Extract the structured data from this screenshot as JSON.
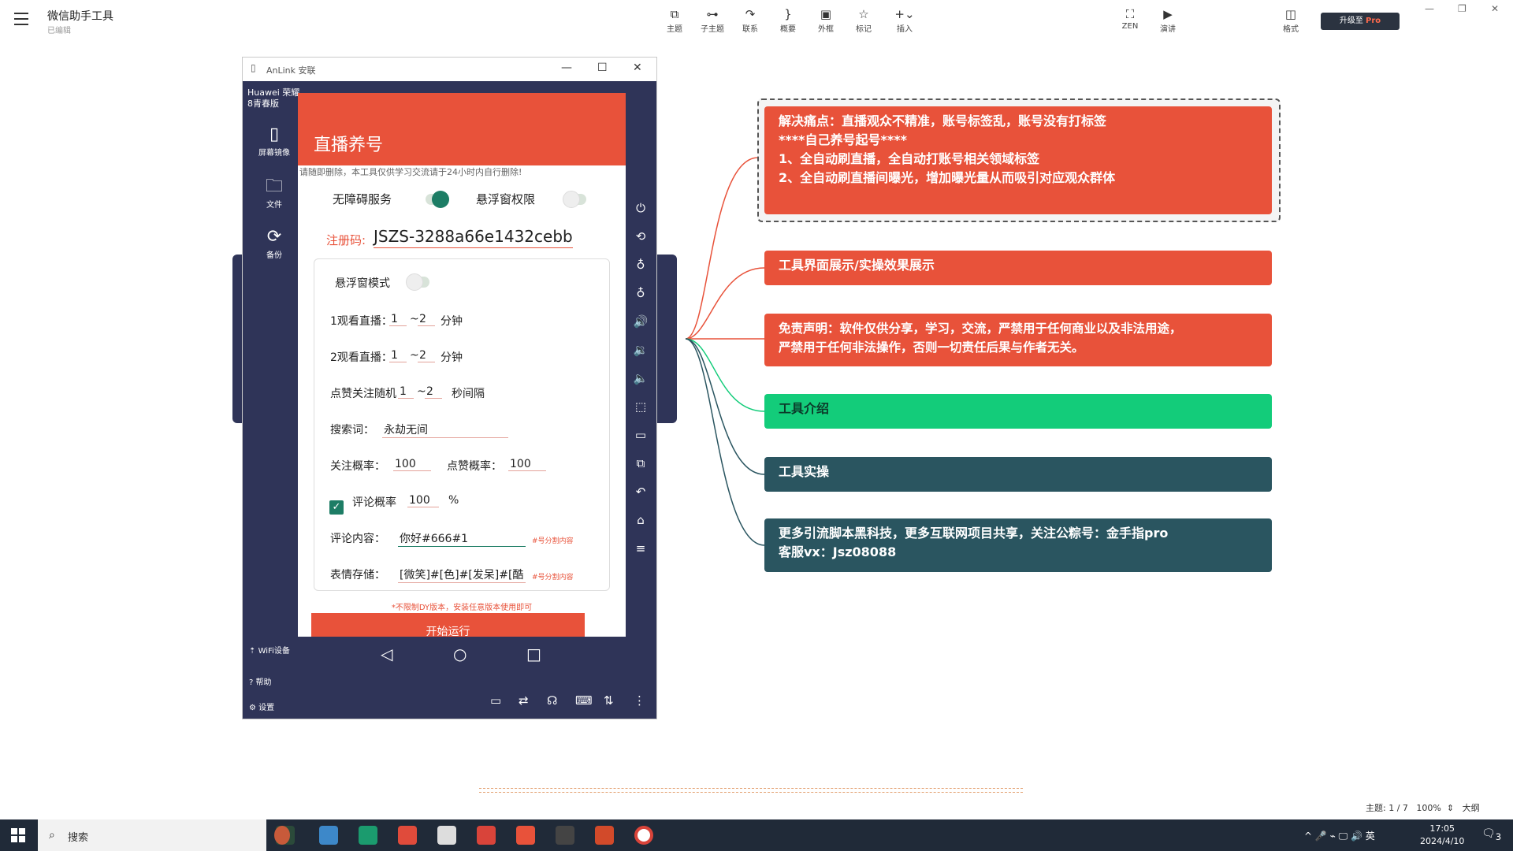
{
  "app": {
    "title": "微信助手工具",
    "subtitle": "已编辑"
  },
  "toolbar": [
    {
      "icon": "topic-icon",
      "glyph": "⧉",
      "label": "主题"
    },
    {
      "icon": "subtopic-icon",
      "glyph": "⊶",
      "label": "子主题"
    },
    {
      "icon": "relation-icon",
      "glyph": "↷",
      "label": "联系"
    },
    {
      "icon": "summary-icon",
      "glyph": "}",
      "label": "概要"
    },
    {
      "icon": "boundary-icon",
      "glyph": "▣",
      "label": "外框"
    },
    {
      "icon": "marker-icon",
      "glyph": "☆",
      "label": "标记"
    },
    {
      "icon": "insert-icon",
      "glyph": "+⌄",
      "label": "插入"
    },
    {
      "icon": "zen-icon",
      "glyph": "⛶",
      "label": "ZEN"
    },
    {
      "icon": "present-icon",
      "glyph": "▶",
      "label": "演讲"
    },
    {
      "icon": "format-icon",
      "glyph": "◫",
      "label": "格式"
    }
  ],
  "upgrade": {
    "prefix": "升级至",
    "brand": "Pro"
  },
  "phone_window": {
    "title": "AnLink 安联",
    "device": "Huawei 荣耀8青春版",
    "side_buttons": [
      {
        "icon": "screen-mirror-icon",
        "glyph": "▯",
        "label": "屏幕镜像"
      },
      {
        "icon": "folder-icon",
        "glyph": "🗀",
        "label": "文件"
      },
      {
        "icon": "backup-icon",
        "glyph": "⟳",
        "label": "备份"
      }
    ],
    "side_lower": [
      {
        "icon": "wifi-icon",
        "glyph": "⇡",
        "label": "WiFi设备"
      },
      {
        "icon": "help-icon",
        "glyph": "?",
        "label": "帮助"
      },
      {
        "icon": "settings-icon",
        "glyph": "⚙",
        "label": "设置"
      }
    ]
  },
  "screen": {
    "title": "直播养号",
    "notice": "请随即删除，本工具仅供学习交流请于24小时内自行删除!",
    "accessibility_label": "无障碍服务",
    "float_perm_label": "悬浮窗权限",
    "reg_label": "注册码:",
    "reg_code": "JSZS-3288a66e1432cebb",
    "float_mode_label": "悬浮窗模式",
    "watch1": {
      "label": "1观看直播：",
      "min": "1",
      "sep": "~",
      "max": "2",
      "unit": "分钟"
    },
    "watch2": {
      "label": "2观看直播：",
      "min": "1",
      "sep": "~",
      "max": "2",
      "unit": "分钟"
    },
    "like_follow": {
      "label": "点赞关注随机",
      "min": "1",
      "sep": "~",
      "max": "2",
      "unit": "秒间隔"
    },
    "search": {
      "label": "搜索词：",
      "value": "永劫无间"
    },
    "follow_rate": {
      "label": "关注概率：",
      "value": "100"
    },
    "like_rate": {
      "label": "点赞概率：",
      "value": "100"
    },
    "comment_rate": {
      "label": "评论概率",
      "value": "100",
      "unit": "%"
    },
    "comment": {
      "label": "评论内容：",
      "value": "你好#666#1",
      "hint": "#号分割内容"
    },
    "emoji": {
      "label": "表情存储：",
      "value": "[微笑]#[色]#[发呆]#[酷",
      "hint": "#号分割内容"
    },
    "footnote": "*不限制DY版本，安装任意版本使用即可",
    "start": "开始运行"
  },
  "mindmap": {
    "nodes": [
      {
        "lines": [
          "解决痛点：直播观众不精准，账号标签乱，账号没有打标签",
          "****自己养号起号****",
          "1、全自动刷直播，全自动打账号相关领域标签",
          "2、全自动刷直播间曝光，增加曝光量从而吸引对应观众群体"
        ]
      },
      {
        "lines": [
          "工具界面展示/实操效果展示"
        ]
      },
      {
        "lines": [
          "免责声明：软件仅供分享，学习，交流，严禁用于任何商业以及非法用途，",
          "严禁用于任何非法操作，否则一切责任后果与作者无关。"
        ]
      },
      {
        "lines": [
          "工具介绍"
        ]
      },
      {
        "lines": [
          "工具实操"
        ]
      },
      {
        "lines": [
          "更多引流脚本黑科技，更多互联网项目共享，关注公粽号：金手指pro",
          "客服vx：Jsz08088"
        ]
      }
    ],
    "colors": {
      "red": "#e8523a",
      "green": "#13cc7a",
      "teal": "#2a5560"
    }
  },
  "status": {
    "topic": "主题: 1 / 7",
    "zoom": "100%",
    "outline": "大纲"
  },
  "taskbar": {
    "search": "搜索",
    "tray": "^ 🎤 ⌁ 🖵 🔊 英",
    "time": "17:05",
    "date": "2024/4/10",
    "notif": "3"
  }
}
